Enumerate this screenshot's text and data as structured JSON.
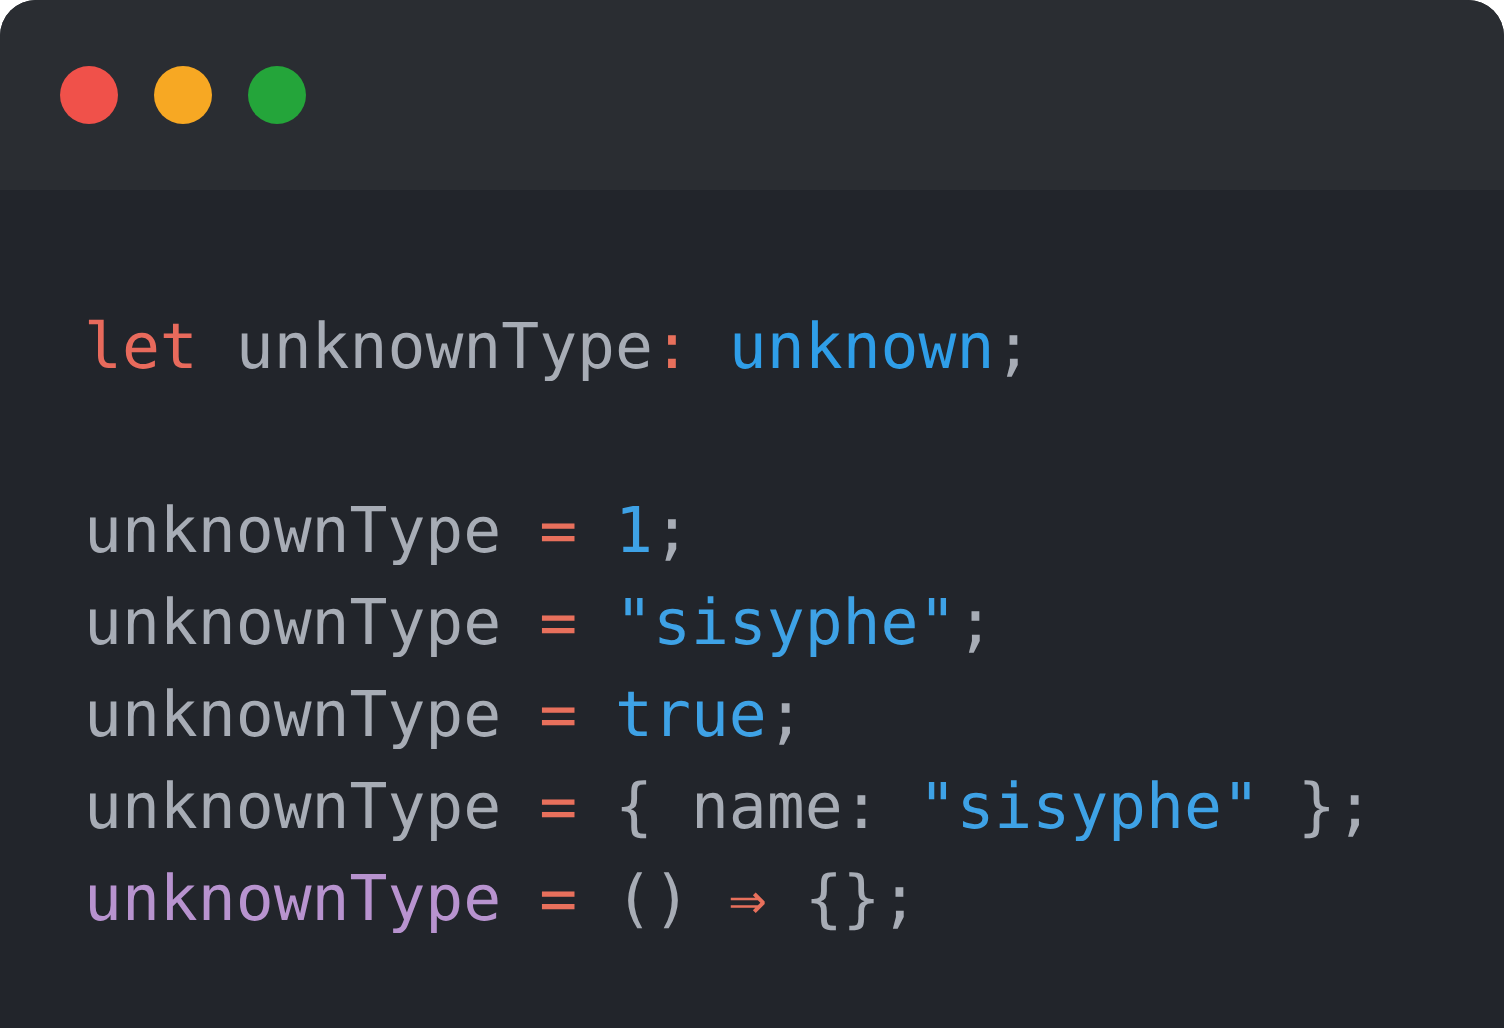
{
  "window": {
    "dots": [
      {
        "color": "#f0514a"
      },
      {
        "color": "#f7a823"
      },
      {
        "color": "#24a53a"
      }
    ]
  },
  "code": {
    "blocks": [
      [
        {
          "tokens": [
            {
              "kind": "keyword",
              "text": "let"
            },
            {
              "kind": "plain",
              "text": " unknownType"
            },
            {
              "kind": "operator",
              "text": ": "
            },
            {
              "kind": "type",
              "text": "unknown"
            },
            {
              "kind": "plain",
              "text": ";"
            }
          ]
        }
      ],
      [
        {
          "tokens": [
            {
              "kind": "plain",
              "text": "unknownType "
            },
            {
              "kind": "operator",
              "text": "= "
            },
            {
              "kind": "literal",
              "text": "1"
            },
            {
              "kind": "plain",
              "text": ";"
            }
          ]
        },
        {
          "tokens": [
            {
              "kind": "plain",
              "text": "unknownType "
            },
            {
              "kind": "operator",
              "text": "= "
            },
            {
              "kind": "literal",
              "text": "\"sisyphe\""
            },
            {
              "kind": "plain",
              "text": ";"
            }
          ]
        },
        {
          "tokens": [
            {
              "kind": "plain",
              "text": "unknownType "
            },
            {
              "kind": "operator",
              "text": "= "
            },
            {
              "kind": "literal",
              "text": "true"
            },
            {
              "kind": "plain",
              "text": ";"
            }
          ]
        },
        {
          "tokens": [
            {
              "kind": "plain",
              "text": "unknownType "
            },
            {
              "kind": "operator",
              "text": "="
            },
            {
              "kind": "plain",
              "text": " { name: "
            },
            {
              "kind": "literal",
              "text": "\"sisyphe\""
            },
            {
              "kind": "plain",
              "text": " };"
            }
          ]
        },
        {
          "tokens": [
            {
              "kind": "function",
              "text": "unknownType "
            },
            {
              "kind": "operator",
              "text": "="
            },
            {
              "kind": "plain",
              "text": " () "
            },
            {
              "kind": "operator",
              "text": "⇒"
            },
            {
              "kind": "plain",
              "text": " {};"
            }
          ]
        }
      ]
    ]
  }
}
